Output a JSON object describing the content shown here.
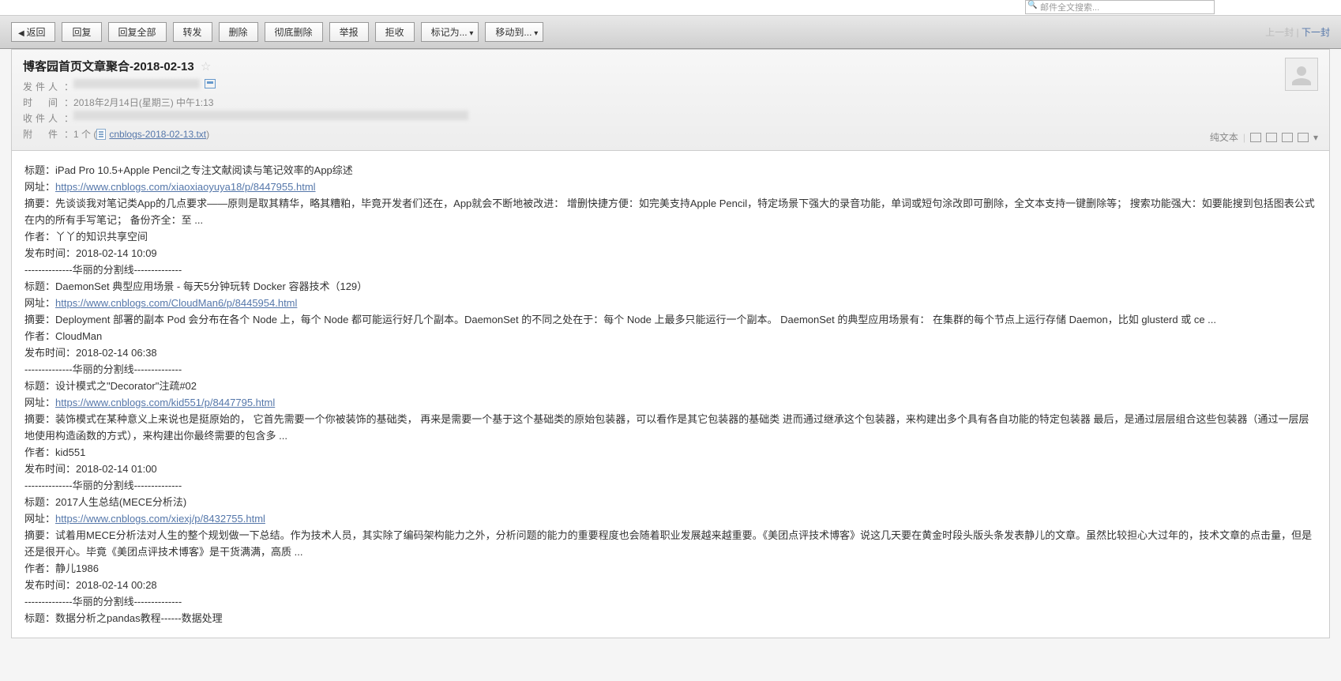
{
  "search": {
    "placeholder": "邮件全文搜索..."
  },
  "toolbar": {
    "back": "返回",
    "reply": "回复",
    "reply_all": "回复全部",
    "forward": "转发",
    "delete": "删除",
    "delete_forever": "彻底删除",
    "report": "举报",
    "reject": "拒收",
    "mark_as": "标记为...",
    "move_to": "移动到...",
    "prev": "上一封",
    "next": "下一封"
  },
  "header": {
    "subject": "博客园首页文章聚合-2018-02-13",
    "labels": {
      "from": "发件人",
      "time": "时　间",
      "to": "收件人",
      "attach": "附　件"
    },
    "time": "2018年2月14日(星期三) 中午1:13",
    "attach_count": "1 个",
    "attach_name": "cnblogs-2018-02-13.txt",
    "view_mode": "纯文本",
    "sep": "|"
  },
  "labels": {
    "title": "标题：",
    "url": "网址：",
    "summary": "摘要：",
    "author": "作者：",
    "pubtime": "发布时间：",
    "divider": "--------------华丽的分割线--------------"
  },
  "articles": [
    {
      "title": "iPad Pro 10.5+Apple Pencil之专注文献阅读与笔记效率的App综述",
      "url": "https://www.cnblogs.com/xiaoxiaoyuya18/p/8447955.html",
      "summary": "先谈谈我对笔记类App的几点要求——原则是取其精华，略其糟粕，毕竟开发者们还在，App就会不断地被改进： 增删快捷方便：如完美支持Apple Pencil，特定场景下强大的录音功能，单词或短句涂改即可删除，全文本支持一键删除等； 搜索功能强大：如要能搜到包括图表公式在内的所有手写笔记； 备份齐全：至 ...",
      "author": "丫丫的知识共享空间",
      "pubtime": "2018-02-14 10:09"
    },
    {
      "title": "DaemonSet 典型应用场景 - 每天5分钟玩转 Docker 容器技术（129）",
      "url": "https://www.cnblogs.com/CloudMan6/p/8445954.html",
      "summary": "Deployment 部署的副本 Pod 会分布在各个 Node 上，每个 Node 都可能运行好几个副本。DaemonSet 的不同之处在于：每个 Node 上最多只能运行一个副本。 DaemonSet 的典型应用场景有： 在集群的每个节点上运行存储 Daemon，比如 glusterd 或 ce ...",
      "author": "CloudMan",
      "pubtime": "2018-02-14 06:38"
    },
    {
      "title": "设计模式之\"Decorator\"注疏#02",
      "url": "https://www.cnblogs.com/kid551/p/8447795.html",
      "summary": "装饰模式在某种意义上来说也是挺原始的， 它首先需要一个你被装饰的基础类， 再来是需要一个基于这个基础类的原始包装器，可以看作是其它包装器的基础类 进而通过继承这个包装器，来构建出多个具有各自功能的特定包装器 最后，是通过层层组合这些包装器（通过一层层地使用构造函数的方式），来构建出你最终需要的包含多 ...",
      "author": "kid551",
      "pubtime": "2018-02-14 01:00"
    },
    {
      "title": "2017人生总结(MECE分析法)",
      "url": "https://www.cnblogs.com/xiexj/p/8432755.html",
      "summary": "试着用MECE分析法对人生的整个规划做一下总结。作为技术人员，其实除了编码架构能力之外，分析问题的能力的重要程度也会随着职业发展越来越重要。《美团点评技术博客》说这几天要在黄金时段头版头条发表静儿的文章。虽然比较担心大过年的，技术文章的点击量，但是还是很开心。毕竟《美团点评技术博客》是干货满满，高质 ...",
      "author": "静儿1986",
      "pubtime": "2018-02-14 00:28"
    }
  ],
  "trailing": {
    "title": "数据分析之pandas教程------数据处理"
  }
}
